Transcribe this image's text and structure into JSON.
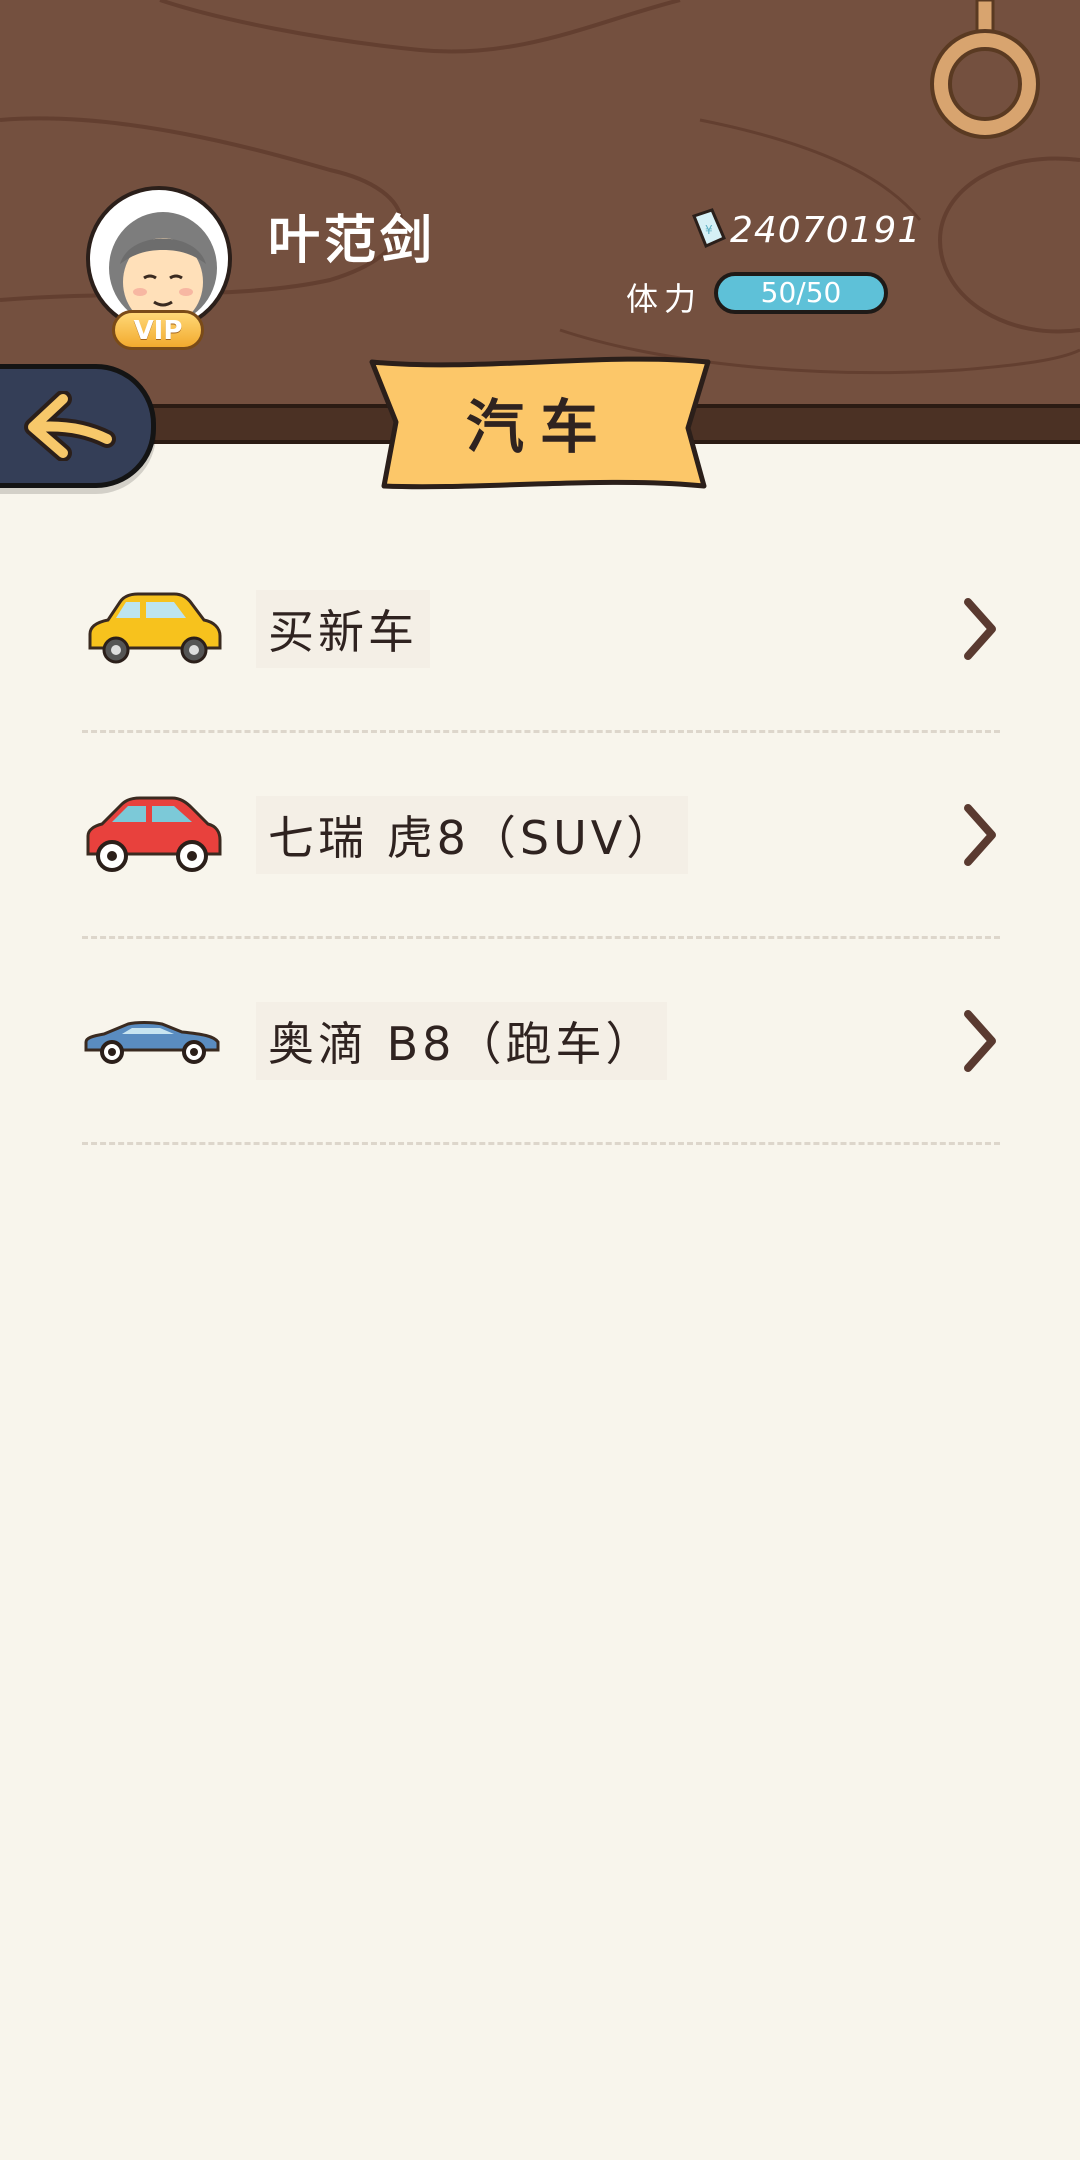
{
  "header": {
    "player_name": "叶范剑",
    "vip_label": "VIP",
    "money": "24070191",
    "stamina_label": "体力",
    "stamina_value": "50/50"
  },
  "page": {
    "title": "汽车"
  },
  "menu": {
    "items": [
      {
        "label": "买新车",
        "icon": "yellow-car-icon"
      },
      {
        "label": "七瑞  虎8（SUV）",
        "icon": "red-suv-icon"
      },
      {
        "label": "奥滴  B8（跑车）",
        "icon": "blue-sports-car-icon"
      }
    ]
  },
  "colors": {
    "header_wood": "#74503f",
    "background": "#f8f5ec",
    "banner": "#fcc769",
    "stamina_bar": "#5ec1d8",
    "back_button": "#343e57"
  }
}
